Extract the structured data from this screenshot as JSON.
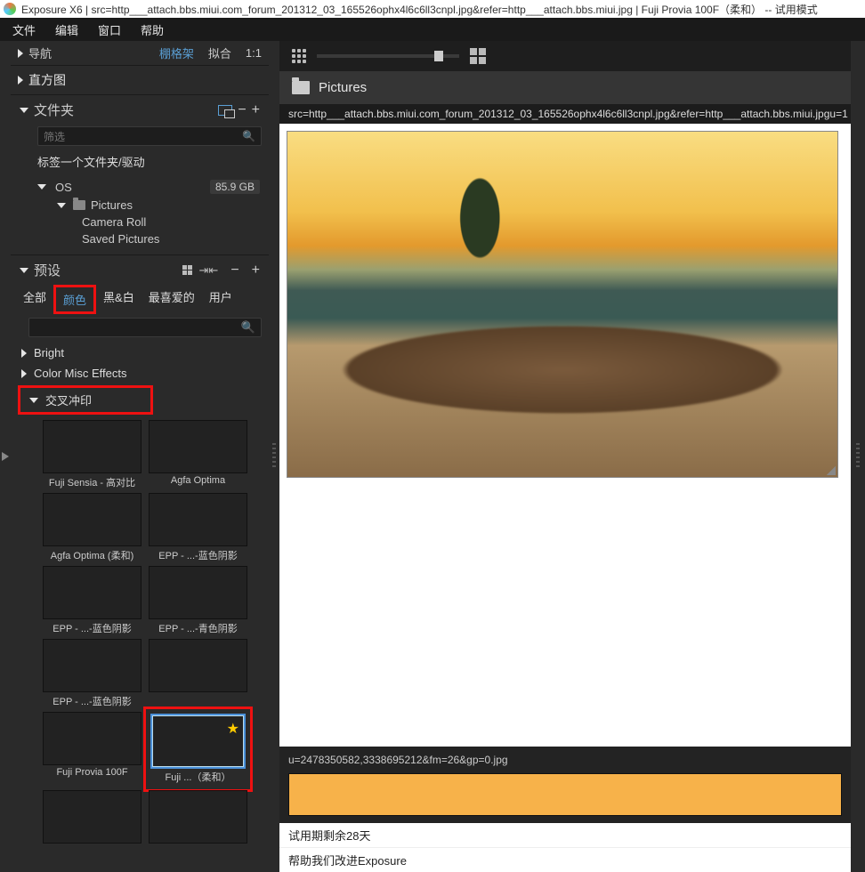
{
  "titlebar": {
    "title": "Exposure X6 | src=http___attach.bbs.miui.com_forum_201312_03_165526ophx4l6c6ll3cnpl.jpg&refer=http___attach.bbs.miui.jpg | Fuji Provia 100F（柔和） -- 试用模式"
  },
  "menubar": [
    "文件",
    "编辑",
    "窗口",
    "帮助"
  ],
  "top_options": {
    "nav": "导航",
    "grid_shelf": "棚格架",
    "fit": "拟合",
    "ratio": "1:1",
    "histogram": "直方图"
  },
  "folders": {
    "title": "文件夹",
    "filter_placeholder": "筛选",
    "tag_hint": "标签一个文件夹/驱动",
    "os_label": "OS",
    "os_size": "85.9 GB",
    "pictures": "Pictures",
    "cam_roll": "Camera Roll",
    "saved": "Saved Pictures"
  },
  "presets": {
    "title": "预设",
    "tabs": {
      "all": "全部",
      "color": "颜色",
      "bw": "黑&白",
      "fav": "最喜爱的",
      "user": "用户"
    },
    "groups": {
      "bright": "Bright",
      "color_misc": "Color Misc Effects",
      "cross": "交叉冲印"
    },
    "items": [
      {
        "label": "Fuji Sensia - 高对比",
        "kind": "warm"
      },
      {
        "label": "Agfa Optima",
        "kind": "cool"
      },
      {
        "label": "Agfa Optima (柔和)",
        "kind": "mid"
      },
      {
        "label": "EPP - ...-蓝色阴影",
        "kind": "blue"
      },
      {
        "label": "EPP - ...-蓝色阴影",
        "kind": "cool"
      },
      {
        "label": "EPP - ...-青色阴影",
        "kind": "cool"
      },
      {
        "label": "EPP - ...-蓝色阴影",
        "kind": "warm"
      },
      {
        "label": "",
        "kind": "warm"
      },
      {
        "label": "Fuji Provia 100F",
        "kind": "sel"
      },
      {
        "label": "Fuji ...（柔和）",
        "kind": "sel",
        "selected": true
      },
      {
        "label": "",
        "kind": "warm"
      },
      {
        "label": "",
        "kind": "warm"
      }
    ]
  },
  "breadcrumb": {
    "label": "Pictures"
  },
  "main_file": "src=http___attach.bbs.miui.com_forum_201312_03_165526ophx4l6c6ll3cnpl.jpg&refer=http___attach.bbs.miui.jpg",
  "right_file_frag": "u=1",
  "thumb_caption": "u=2478350582,3338695212&fm=26&gp=0.jpg",
  "trial_text": "试用期剩余28天",
  "help_text": "帮助我们改进Exposure"
}
